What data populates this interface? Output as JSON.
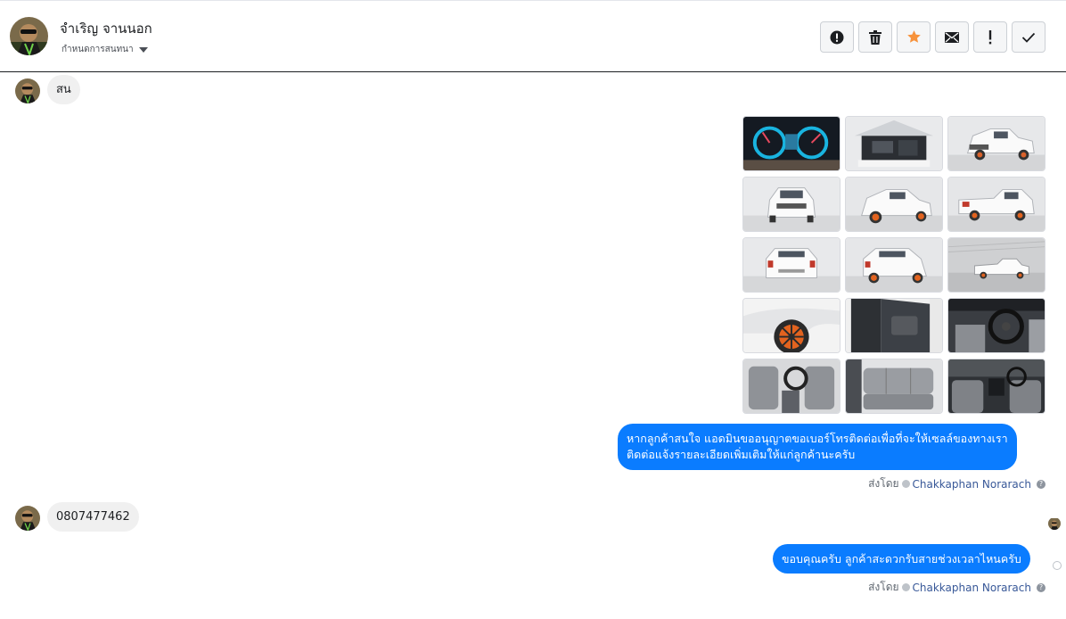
{
  "header": {
    "contact_name": "จำเริญ จานนอก",
    "status_label": "กำหนดการสนทนา"
  },
  "toolbar": {
    "buttons": [
      {
        "name": "spam",
        "icon": "alert-circle-icon"
      },
      {
        "name": "delete",
        "icon": "trash-icon"
      },
      {
        "name": "star",
        "icon": "star-icon",
        "color": "#f7923b"
      },
      {
        "name": "unread",
        "icon": "envelope-icon"
      },
      {
        "name": "important",
        "icon": "exclamation-icon"
      },
      {
        "name": "done",
        "icon": "check-icon"
      }
    ]
  },
  "messages": {
    "incoming_1": "สน",
    "photo_count": 15,
    "outgoing_1_line1": "หากลูกค้าสนใจ แอดมินขออนุญาตขอเบอร์โทรติดต่อเพื่อที่จะให้เซลล์ของทางเรา",
    "outgoing_1_line2": "ติดต่อแจ้งรายละเอียดเพิ่มเติมให้แก่ลูกค้านะครับ",
    "sent_by_label": "ส่งโดย",
    "agent_name": "Chakkaphan Norarach",
    "incoming_2": "0807477462",
    "outgoing_2": "ขอบคุณครับ ลูกค้าสะดวกรับสายช่วงเวลาไหนครับ"
  },
  "colors": {
    "outgoing_bubble": "#0a7cff",
    "incoming_bubble": "#f0f0f0",
    "star": "#f7923b"
  }
}
